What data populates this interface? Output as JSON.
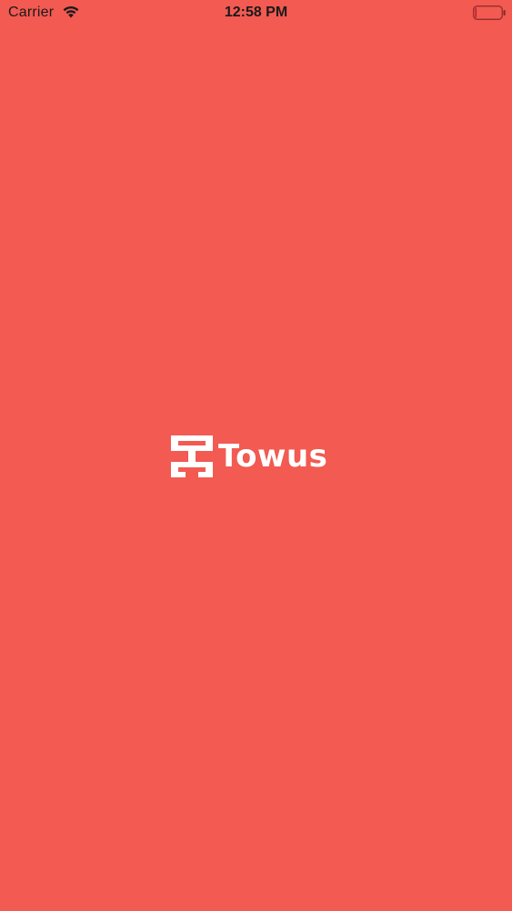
{
  "colors": {
    "background": "#F25A52",
    "status_text": "#1a1a1a",
    "logo": "#FFFFFF"
  },
  "status_bar": {
    "carrier": "Carrier",
    "time": "12:58 PM",
    "wifi_icon": "wifi-icon",
    "battery_icon": "battery-icon",
    "battery_level": 0.05
  },
  "splash": {
    "logo_icon": "towus-logo-mark-icon",
    "brand_name": "Towus"
  }
}
